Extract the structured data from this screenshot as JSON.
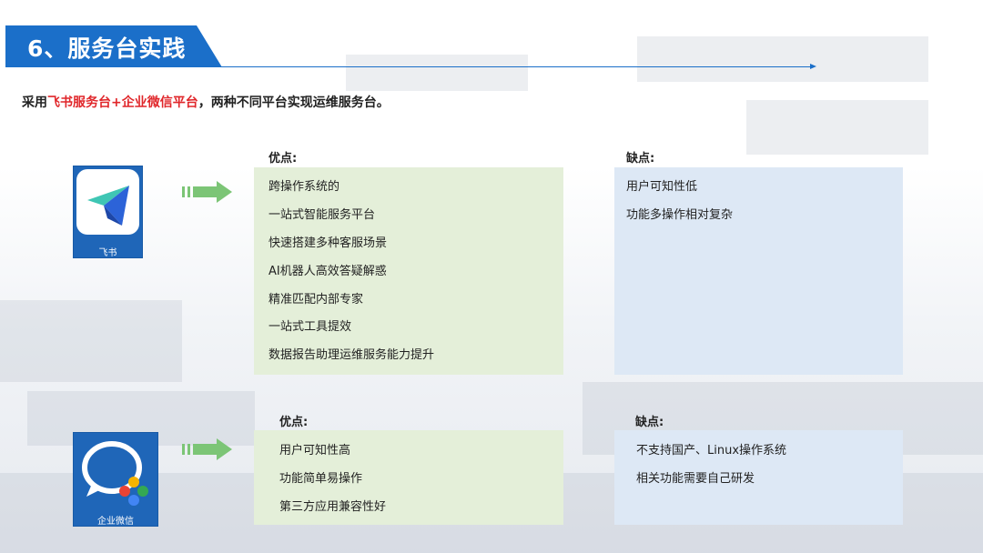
{
  "header": {
    "title": "6、服务台实践"
  },
  "intro": {
    "prefix": "采用",
    "highlight1": "飞书服务台",
    "plus": "+",
    "highlight2": "企业微信平台",
    "suffix": "，两种不同平台实现运维服务台。"
  },
  "platforms": [
    {
      "app_name": "飞书",
      "pros_heading": "优点:",
      "cons_heading": "缺点:",
      "pros": [
        "跨操作系统的",
        "一站式智能服务平台",
        "快速搭建多种客服场景",
        "AI机器人高效答疑解惑",
        "精准匹配内部专家",
        "一站式工具提效",
        "数据报告助理运维服务能力提升"
      ],
      "cons": [
        "用户可知性低",
        "功能多操作相对复杂"
      ]
    },
    {
      "app_name": "企业微信",
      "pros_heading": "优点:",
      "cons_heading": "缺点:",
      "pros": [
        "用户可知性高",
        "功能简单易操作",
        "第三方应用兼容性好"
      ],
      "cons": [
        "不支持国产、Linux操作系统",
        "相关功能需要自己研发"
      ]
    }
  ],
  "colors": {
    "title_blue": "#1b6fc9",
    "highlight_red": "#e0262a",
    "pros_panel": "#e4efd9",
    "cons_panel": "#dde8f5",
    "arrow_green": "#7cc576"
  }
}
